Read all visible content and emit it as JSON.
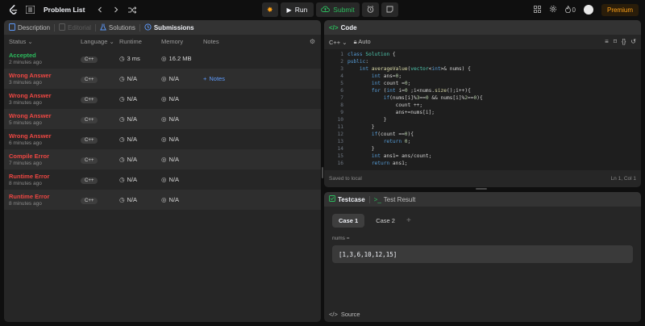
{
  "topbar": {
    "title": "Problem List",
    "run_label": "Run",
    "submit_label": "Submit",
    "streak": "0",
    "premium_label": "Premium"
  },
  "left": {
    "tabs": [
      {
        "label": "Description"
      },
      {
        "label": "Editorial"
      },
      {
        "label": "Solutions"
      },
      {
        "label": "Submissions"
      }
    ],
    "headers": {
      "status": "Status",
      "language": "Language",
      "runtime": "Runtime",
      "memory": "Memory",
      "notes": "Notes"
    },
    "rows": [
      {
        "status": "Accepted",
        "time": "2 minutes ago",
        "lang": "C++",
        "runtime": "3 ms",
        "memory": "16.2 MB",
        "note": ""
      },
      {
        "status": "Wrong Answer",
        "time": "3 minutes ago",
        "lang": "C++",
        "runtime": "N/A",
        "memory": "N/A",
        "note": "Notes"
      },
      {
        "status": "Wrong Answer",
        "time": "3 minutes ago",
        "lang": "C++",
        "runtime": "N/A",
        "memory": "N/A",
        "note": ""
      },
      {
        "status": "Wrong Answer",
        "time": "5 minutes ago",
        "lang": "C++",
        "runtime": "N/A",
        "memory": "N/A",
        "note": ""
      },
      {
        "status": "Wrong Answer",
        "time": "6 minutes ago",
        "lang": "C++",
        "runtime": "N/A",
        "memory": "N/A",
        "note": ""
      },
      {
        "status": "Compile Error",
        "time": "7 minutes ago",
        "lang": "C++",
        "runtime": "N/A",
        "memory": "N/A",
        "note": ""
      },
      {
        "status": "Runtime Error",
        "time": "8 minutes ago",
        "lang": "C++",
        "runtime": "N/A",
        "memory": "N/A",
        "note": ""
      },
      {
        "status": "Runtime Error",
        "time": "8 minutes ago",
        "lang": "C++",
        "runtime": "N/A",
        "memory": "N/A",
        "note": ""
      }
    ]
  },
  "code": {
    "tab_label": "Code",
    "language": "C++",
    "mode": "Auto",
    "lines": [
      "class Solution {",
      "public:",
      "    int averageValue(vector<int>& nums) {",
      "        int ans=0;",
      "        int count =0;",
      "        for (int i=0 ;i<nums.size();i++){",
      "            if(nums[i]%3==0 && nums[i]%2==0){",
      "                count ++;",
      "                ans+=nums[i];",
      "            }",
      "        }",
      "        if(count ==0){",
      "            return 0;",
      "        }",
      "        int ans1= ans/count;",
      "        return ans1;"
    ],
    "saved": "Saved to local",
    "position": "Ln 1, Col 1"
  },
  "test": {
    "tab_testcase": "Testcase",
    "tab_result": "Test Result",
    "cases": [
      "Case 1",
      "Case 2"
    ],
    "var_name": "nums =",
    "var_value": "[1,3,6,10,12,15]",
    "source_label": "Source"
  },
  "colors": {
    "accepted": "#2cbb5d",
    "error": "#ef4743",
    "accent": "#ffa116",
    "link": "#5e9cff"
  }
}
